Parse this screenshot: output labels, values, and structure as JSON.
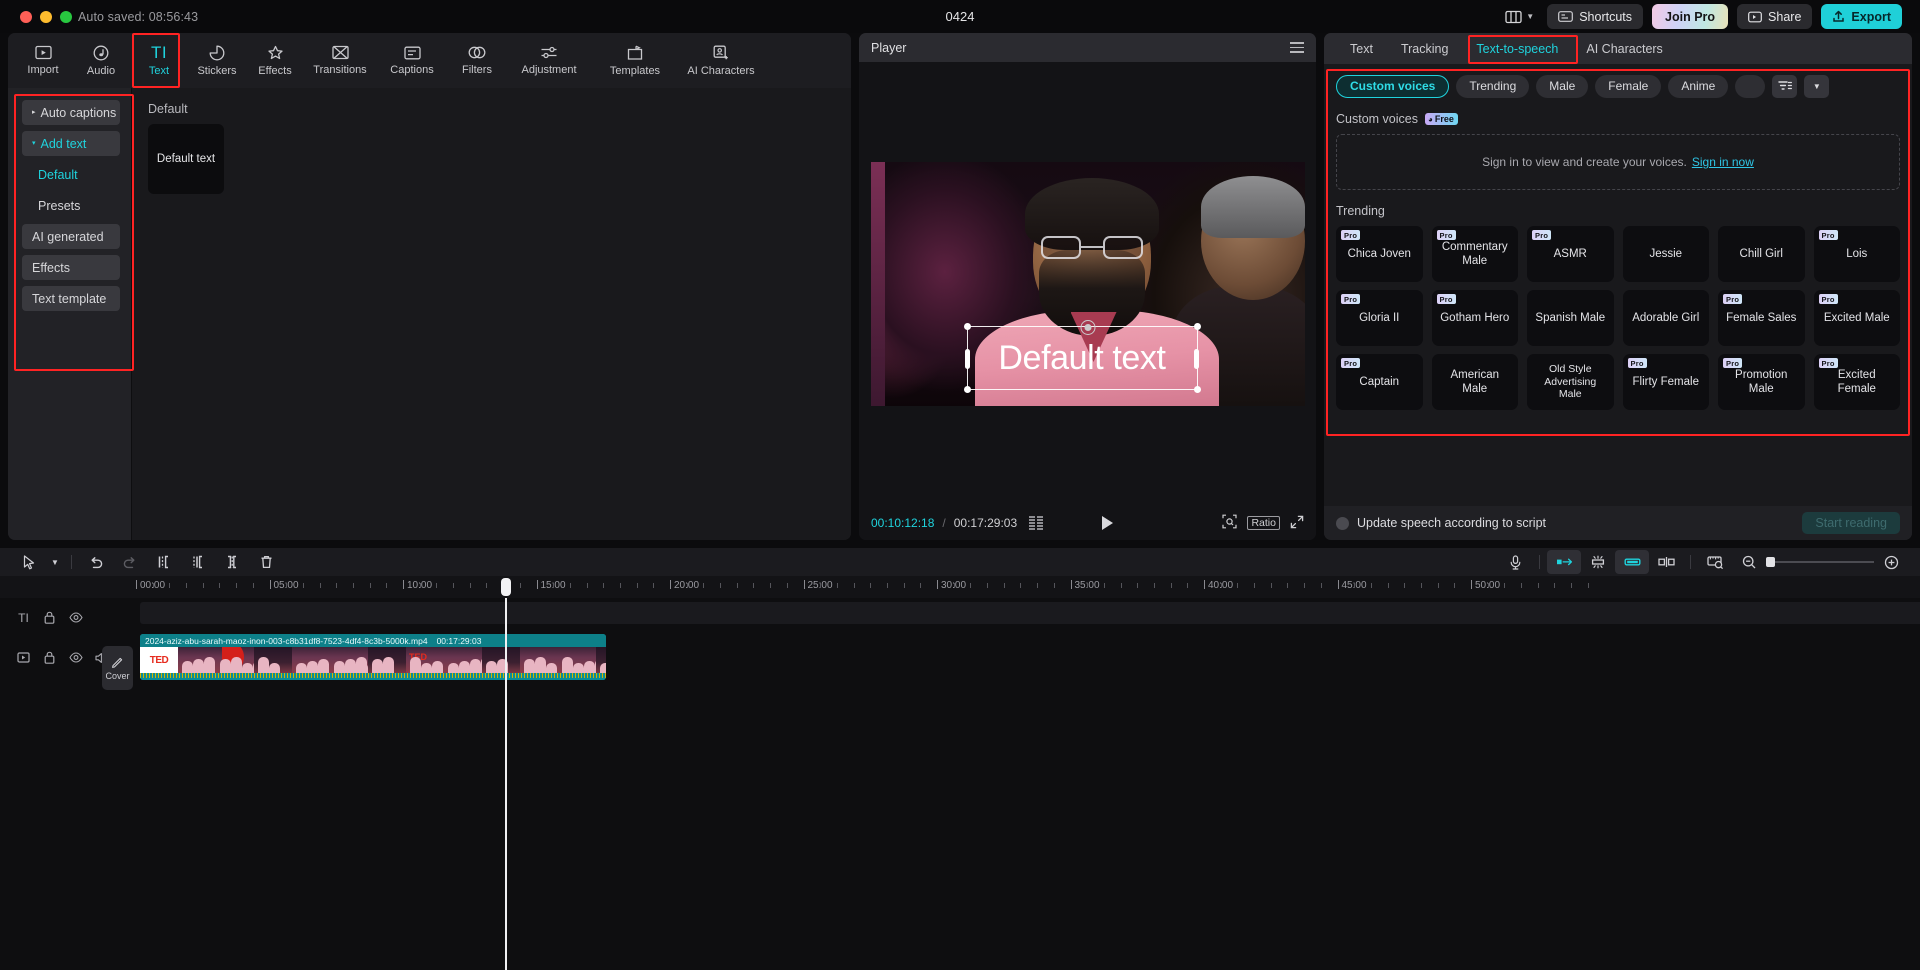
{
  "titlebar": {
    "autosave": "Auto saved: 08:56:43",
    "project_title": "0424",
    "shortcuts": "Shortcuts",
    "join_pro": "Join Pro",
    "share": "Share",
    "export": "Export"
  },
  "toolbar": {
    "items": [
      {
        "label": "Import",
        "icon": "import-icon"
      },
      {
        "label": "Audio",
        "icon": "audio-icon"
      },
      {
        "label": "Text",
        "icon": "text-icon"
      },
      {
        "label": "Stickers",
        "icon": "stickers-icon"
      },
      {
        "label": "Effects",
        "icon": "effects-icon"
      },
      {
        "label": "Transitions",
        "icon": "transitions-icon"
      },
      {
        "label": "Captions",
        "icon": "captions-icon"
      },
      {
        "label": "Filters",
        "icon": "filters-icon"
      },
      {
        "label": "Adjustment",
        "icon": "adjustment-icon"
      },
      {
        "label": "Templates",
        "icon": "templates-icon"
      },
      {
        "label": "AI Characters",
        "icon": "ai-characters-icon"
      }
    ],
    "active": "Text"
  },
  "subnav": {
    "items": [
      {
        "label": "Auto captions",
        "caret": "▸",
        "type": "group"
      },
      {
        "label": "Add text",
        "caret": "▾",
        "type": "group",
        "selected": true
      },
      {
        "label": "Default",
        "type": "child",
        "selected": true
      },
      {
        "label": "Presets",
        "type": "child"
      },
      {
        "label": "AI generated",
        "type": "group"
      },
      {
        "label": "Effects",
        "type": "group"
      },
      {
        "label": "Text template",
        "type": "group"
      }
    ]
  },
  "content_pane": {
    "section_label": "Default",
    "card_label": "Default text"
  },
  "player": {
    "title": "Player",
    "overlay_text": "Default text",
    "current_time": "00:10:12:18",
    "total_time": "00:17:29:03",
    "separator": "/",
    "ratio_label": "Ratio"
  },
  "right_panel": {
    "tabs": [
      {
        "label": "Text"
      },
      {
        "label": "Tracking"
      },
      {
        "label": "Text-to-speech",
        "active": true
      },
      {
        "label": "AI Characters"
      }
    ],
    "chips": [
      {
        "label": "Custom voices",
        "active": true
      },
      {
        "label": "Trending"
      },
      {
        "label": "Male"
      },
      {
        "label": "Female"
      },
      {
        "label": "Anime"
      }
    ],
    "filter_icon": "filter-icon",
    "dropdown_icon": "chevron-down-icon",
    "custom_voices": {
      "heading": "Custom voices",
      "badge": "Free",
      "signin_text": "Sign in to view and create your voices.",
      "signin_link": "Sign in now"
    },
    "trending": {
      "heading": "Trending",
      "voices": [
        {
          "name": "Chica Joven",
          "pro": true
        },
        {
          "name": "Commentary Male",
          "pro": true
        },
        {
          "name": "ASMR",
          "pro": true
        },
        {
          "name": "Jessie",
          "pro": false
        },
        {
          "name": "Chill Girl",
          "pro": false
        },
        {
          "name": "Lois",
          "pro": true
        },
        {
          "name": "Gloria II",
          "pro": true
        },
        {
          "name": "Gotham Hero",
          "pro": true
        },
        {
          "name": "Spanish Male",
          "pro": false
        },
        {
          "name": "Adorable Girl",
          "pro": false
        },
        {
          "name": "Female Sales",
          "pro": true
        },
        {
          "name": "Excited Male",
          "pro": true
        },
        {
          "name": "Captain",
          "pro": true
        },
        {
          "name": "American Male",
          "pro": false
        },
        {
          "name": "Old Style Advertising Male",
          "pro": false
        },
        {
          "name": "Flirty Female",
          "pro": true
        },
        {
          "name": "Promotion Male",
          "pro": true
        },
        {
          "name": "Excited Female",
          "pro": true
        }
      ]
    },
    "footer": {
      "checkbox_label": "Update speech according to script",
      "start_button": "Start reading"
    }
  },
  "timeline": {
    "ruler_labels": [
      "00:00",
      "05:00",
      "10:00",
      "15:00",
      "20:00",
      "25:00",
      "30:00",
      "35:00",
      "40:00",
      "45:00",
      "50:00"
    ],
    "cover_label": "Cover",
    "clip": {
      "name": "2024-aziz-abu-sarah-maoz-inon-003-c8b31df8-7523-4df4-8c3b-5000k.mp4",
      "duration": "00:17:29:03",
      "thumb_logo": "TED"
    }
  },
  "colors": {
    "accent": "#1fd3dd",
    "highlight": "#ff2323",
    "clip": "#0b8c96",
    "export": "#1fd0d8"
  }
}
